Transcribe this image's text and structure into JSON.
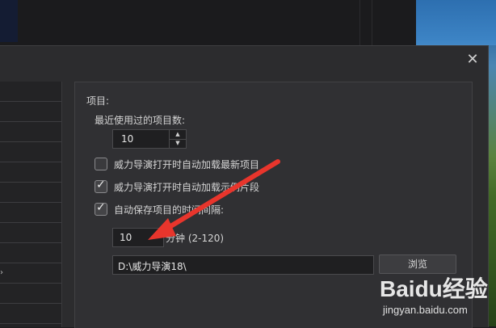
{
  "dialog": {
    "close_icon": "close-icon",
    "panel": {
      "section_title": "项目:",
      "recent_count_label": "最近使用过的项目数:",
      "recent_count_value": "10",
      "checkboxes": [
        {
          "label": "威力导演打开时自动加载最新项目",
          "checked": false
        },
        {
          "label": "威力导演打开时自动加载示例片段",
          "checked": true
        },
        {
          "label": "自动保存项目的时间间隔:",
          "checked": true
        }
      ],
      "autosave_interval_value": "10",
      "autosave_unit": "分钟 (2-120)",
      "path_value": "D:\\威力导演18\\",
      "browse_label": "浏览"
    }
  },
  "annotation": {
    "arrow_color": "#e8352c"
  },
  "watermark": {
    "logo_text": "Baidu经验",
    "url": "jingyan.baidu.com"
  },
  "colors": {
    "dialog_bg": "#2c2c2e",
    "panel_bg": "#303033",
    "input_bg": "#1f1f21"
  }
}
